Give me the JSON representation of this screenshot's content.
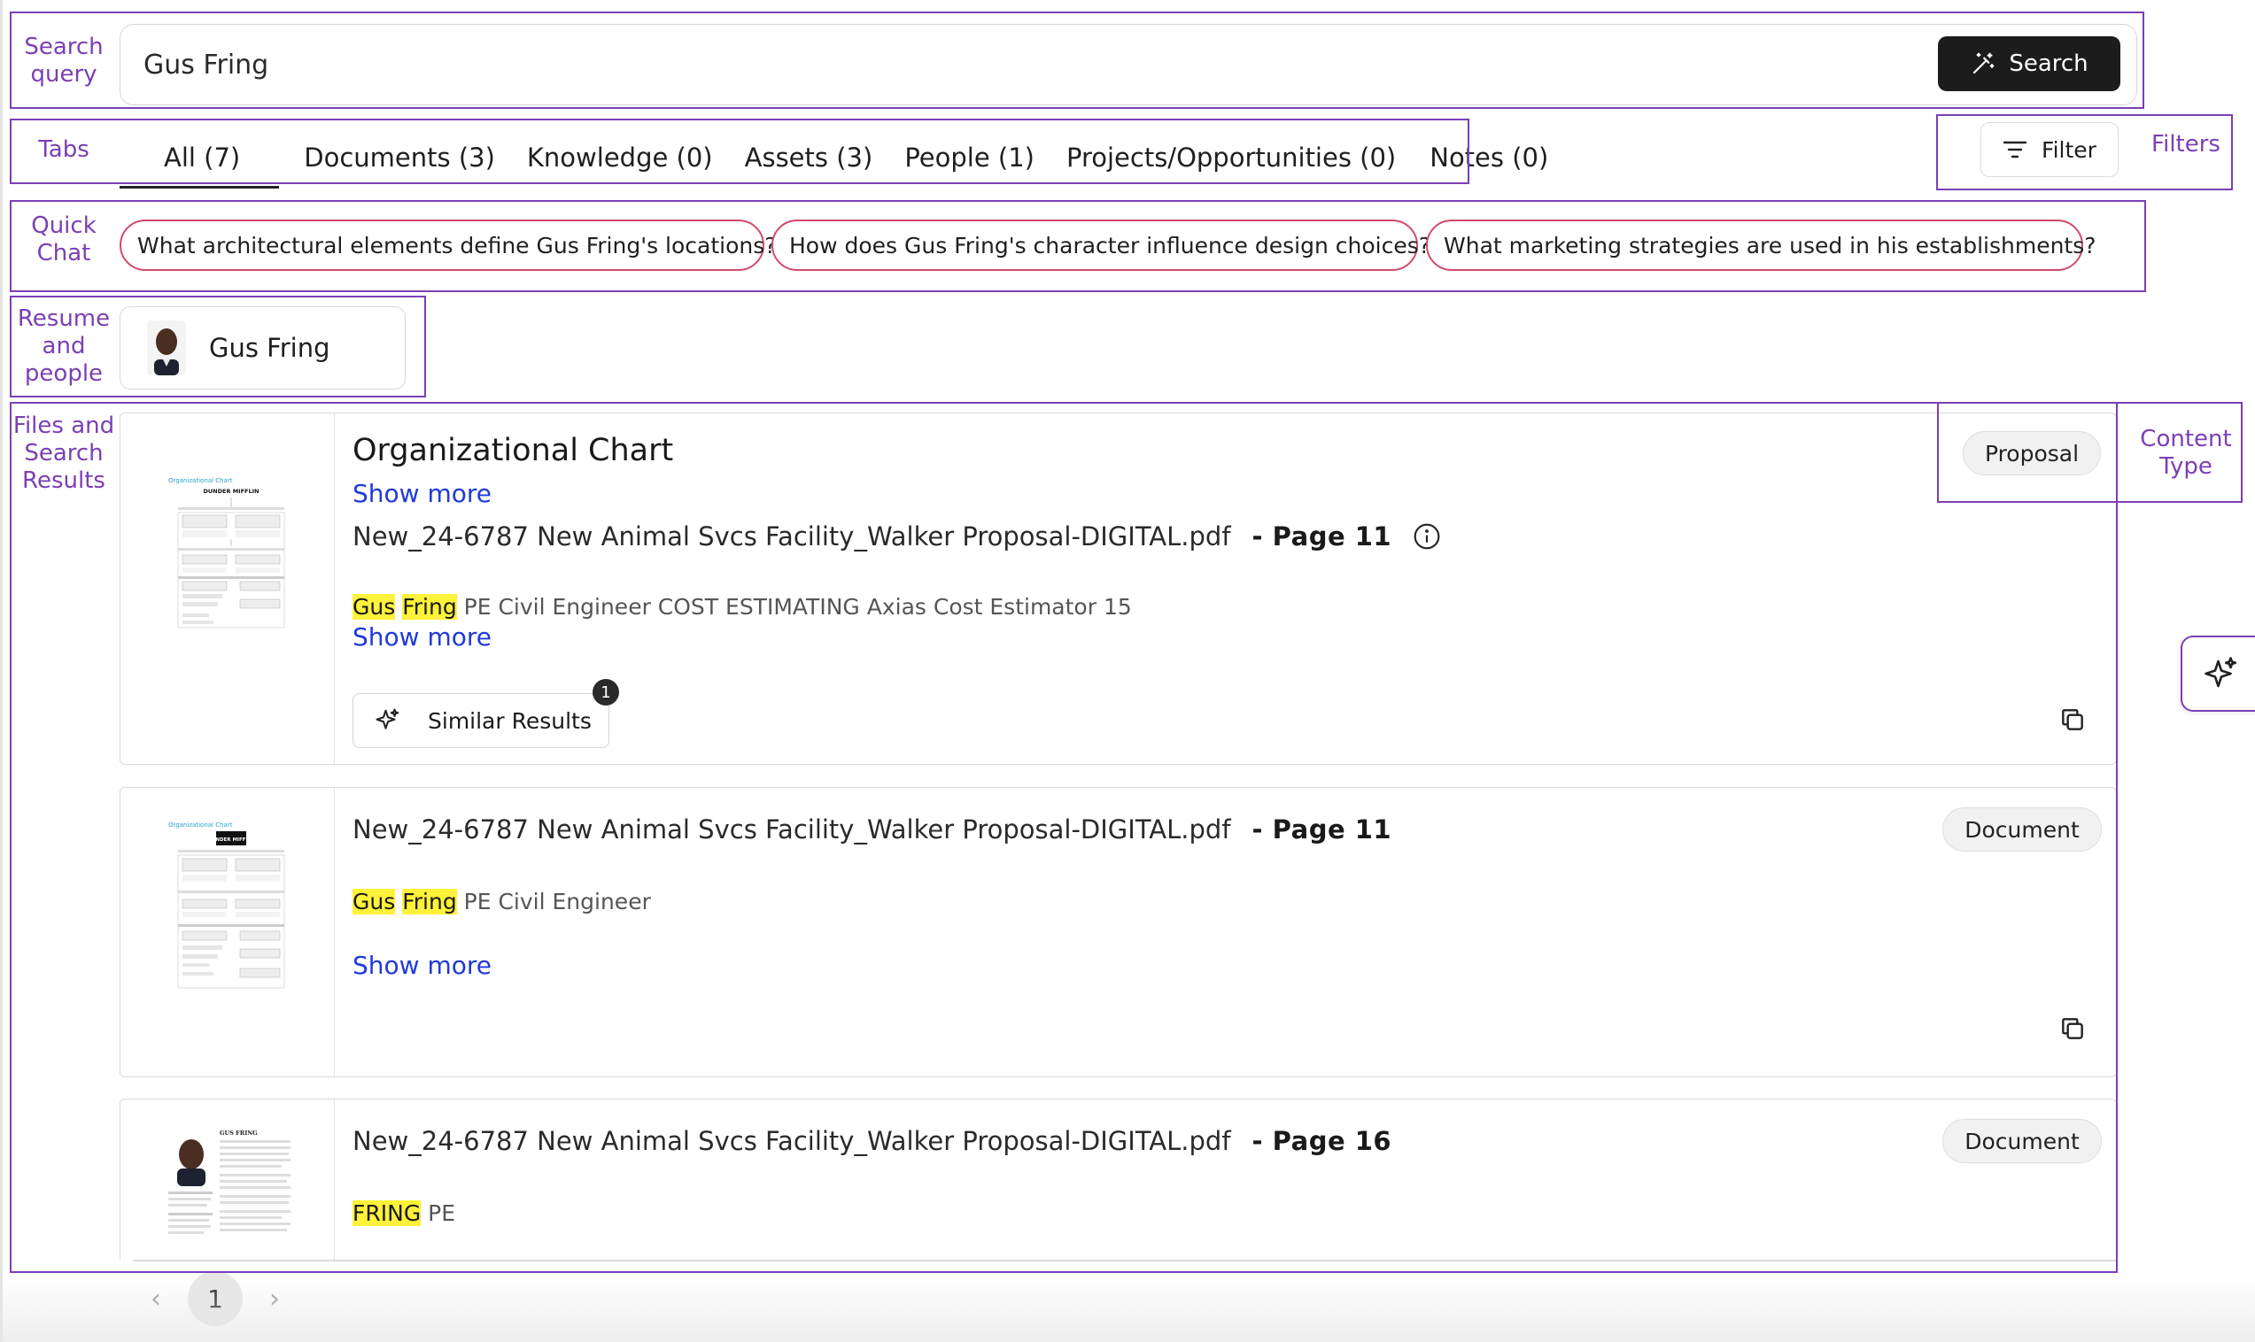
{
  "search": {
    "value": "Gus Fring",
    "button_label": "Search"
  },
  "tabs": [
    {
      "label": "All (7)"
    },
    {
      "label": "Documents (3)"
    },
    {
      "label": "Knowledge (0)"
    },
    {
      "label": "Assets (3)"
    },
    {
      "label": "People (1)"
    },
    {
      "label": "Projects/Opportunities (0)"
    },
    {
      "label": "Notes (0)"
    }
  ],
  "filter": {
    "label": "Filter"
  },
  "quick_chat": [
    {
      "label": "What architectural elements define Gus Fring's locations?"
    },
    {
      "label": "How does Gus Fring's character influence design choices?"
    },
    {
      "label": "What marketing strategies are used in his establishments?"
    }
  ],
  "person": {
    "name": "Gus Fring"
  },
  "annotations": {
    "search_query": "Search\nquery",
    "tabs": "Tabs",
    "filters": "Filters",
    "quick_chat": "Quick\nChat",
    "resume_people": "Resume\nand\npeople",
    "files_results": "Files and\nSearch\nResults",
    "content_type": "Content\nType"
  },
  "results": [
    {
      "title": "Organizational Chart",
      "show_more_top": "Show more",
      "file": "New_24-6787 New Animal Svcs Facility_Walker Proposal-DIGITAL.pdf",
      "page": "- Page 11",
      "snippet_hl1": "Gus",
      "snippet_hl2": "Fring",
      "snippet_rest": "PE Civil Engineer COST ESTIMATING Axias Cost Estimator 15",
      "show_more": "Show more",
      "similar_label": "Similar Results",
      "similar_count": "1",
      "badge": "Proposal",
      "thumb_title": "Organizational Chart",
      "thumb_logo": "DUNDER MIFFLIN"
    },
    {
      "file": "New_24-6787 New Animal Svcs Facility_Walker Proposal-DIGITAL.pdf",
      "page": "- Page 11",
      "snippet_hl1": "Gus",
      "snippet_hl2": "Fring",
      "snippet_rest": "PE Civil Engineer",
      "show_more": "Show more",
      "badge": "Document",
      "thumb_title": "Organizational Chart",
      "thumb_logo": "DUNDER MIFFLIN"
    },
    {
      "file": "New_24-6787 New Animal Svcs Facility_Walker Proposal-DIGITAL.pdf",
      "page": "- Page 16",
      "snippet_hl1": "FRING",
      "snippet_rest": "PE",
      "badge": "Document",
      "thumb_title": "GUS FRING"
    }
  ],
  "pagination": {
    "current": "1"
  },
  "colors": {
    "annotation": "#7b3fb5",
    "chip_border": "#d24a6a",
    "link": "#1f3ad6",
    "highlight": "#fff23a",
    "search_button": "#1c1c1c"
  }
}
